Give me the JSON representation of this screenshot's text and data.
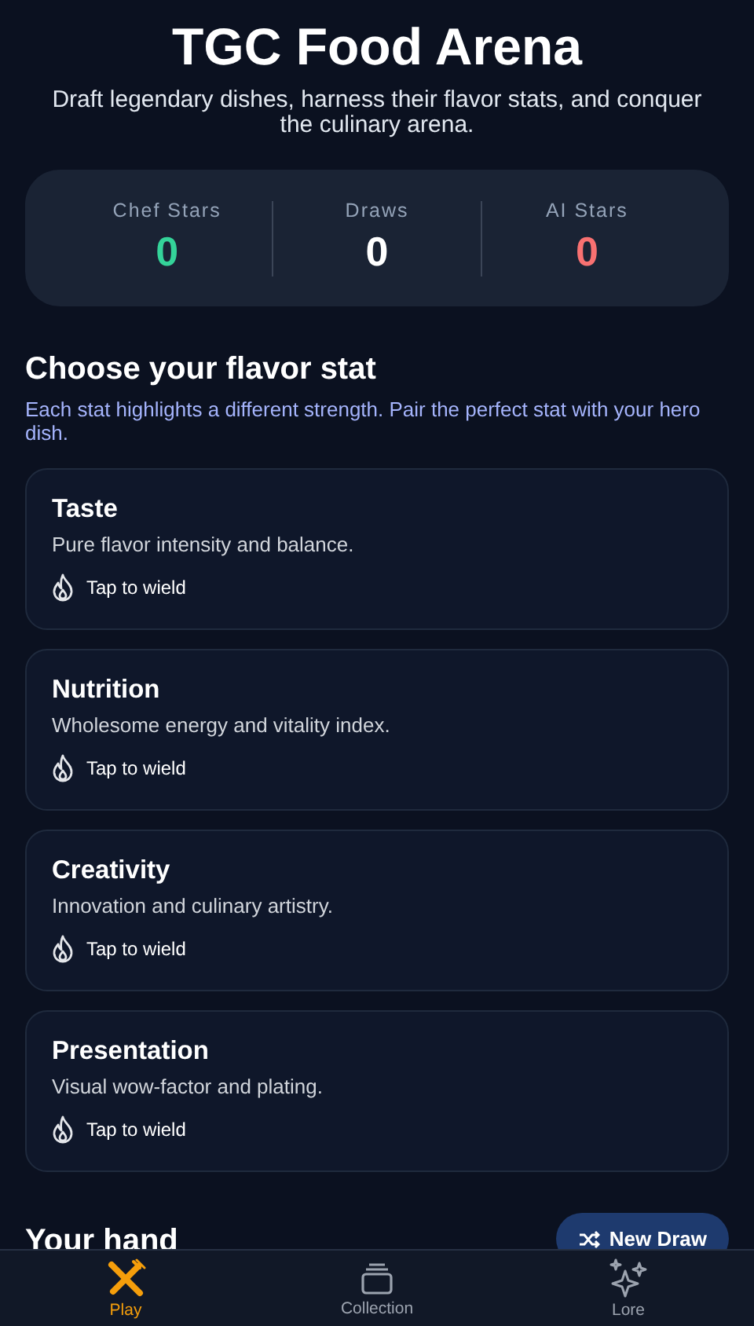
{
  "header": {
    "title": "TGC Food Arena",
    "subtitle": "Draft legendary dishes, harness their flavor stats, and conquer the culinary arena."
  },
  "scoreboard": [
    {
      "label": "Chef Stars",
      "value": "0",
      "color": "#34d399"
    },
    {
      "label": "Draws",
      "value": "0",
      "color": "#ffffff"
    },
    {
      "label": "AI Stars",
      "value": "0",
      "color": "#f87171"
    }
  ],
  "stat_section": {
    "title": "Choose your flavor stat",
    "description": "Each stat highlights a different strength. Pair the perfect stat with your hero dish.",
    "stats": [
      {
        "name": "Taste",
        "description": "Pure flavor intensity and balance.",
        "action": "Tap to wield"
      },
      {
        "name": "Nutrition",
        "description": "Wholesome energy and vitality index.",
        "action": "Tap to wield"
      },
      {
        "name": "Creativity",
        "description": "Innovation and culinary artistry.",
        "action": "Tap to wield"
      },
      {
        "name": "Presentation",
        "description": "Visual wow-factor and plating.",
        "action": "Tap to wield"
      }
    ]
  },
  "hand": {
    "title": "Your hand",
    "button": "New Draw"
  },
  "nav": [
    {
      "label": "Play",
      "kind": "play",
      "selected": true
    },
    {
      "label": "Collection",
      "kind": "collection",
      "selected": false
    },
    {
      "label": "Lore",
      "kind": "lore",
      "selected": false
    }
  ]
}
